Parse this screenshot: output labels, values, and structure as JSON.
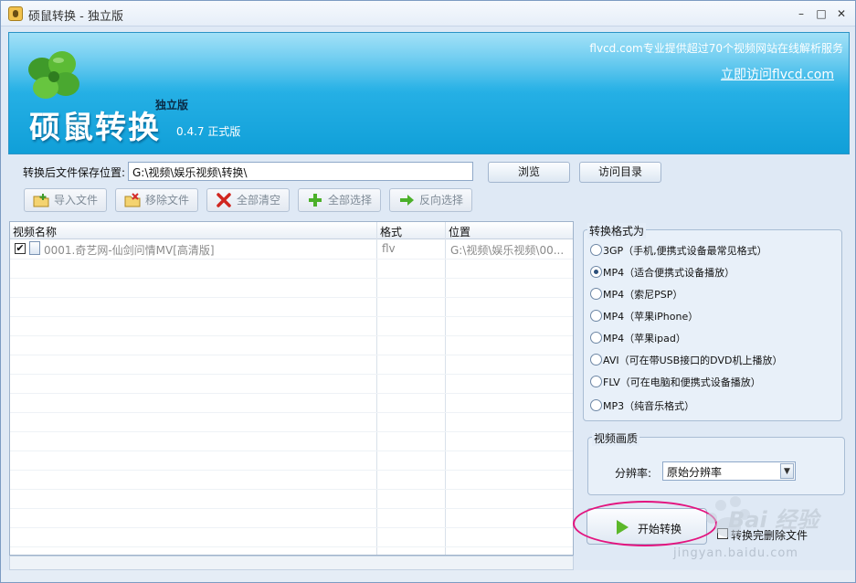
{
  "window": {
    "title": "硕鼠转换 - 独立版",
    "controls": {
      "minimize": "–",
      "maximize": "□",
      "close": "✕"
    }
  },
  "banner": {
    "brand": "硕鼠转换",
    "edition": "独立版",
    "version": "0.4.7 正式版",
    "slogan": "flvcd.com专业提供超过70个视频网站在线解析服务",
    "link": "立即访问flvcd.com"
  },
  "save": {
    "label": "转换后文件保存位置:",
    "path": "G:\\视频\\娱乐视频\\转换\\",
    "browse_label": "浏览",
    "open_label": "访问目录"
  },
  "toolbar": {
    "import": "导入文件",
    "remove": "移除文件",
    "clear_all": "全部清空",
    "select_all": "全部选择",
    "invert": "反向选择"
  },
  "file_list": {
    "columns": [
      "视频名称",
      "格式",
      "位置"
    ],
    "rows": [
      {
        "checked": "✔",
        "name": "0001.奇艺网-仙剑问情MV[高清版]",
        "format": "flv",
        "location": "G:\\视频\\娱乐视频\\00..."
      }
    ]
  },
  "format_panel": {
    "title": "转换格式为",
    "options": [
      "3GP（手机,便携式设备最常见格式）",
      "MP4（适合便携式设备播放）",
      "MP4（索尼PSP）",
      "MP4（苹果iPhone）",
      "MP4（苹果ipad）",
      "AVI（可在带USB接口的DVD机上播放）",
      "FLV（可在电脑和便携式设备播放）",
      "MP3（纯音乐格式）"
    ],
    "selected_index": 1
  },
  "quality_panel": {
    "title": "视频画质",
    "resolution_label": "分辨率:",
    "resolution_value": "原始分辨率"
  },
  "actions": {
    "start_label": "开始转换",
    "after_label": "转换完删除文件"
  },
  "watermark": {
    "text": "Bai 经验",
    "url": "jingyan.baidu.com"
  }
}
